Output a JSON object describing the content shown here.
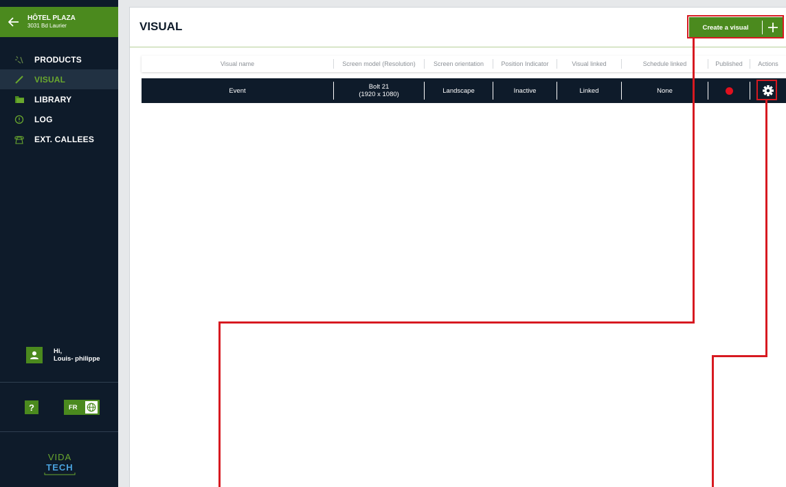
{
  "hotel": {
    "name": "HÔTEL PLAZA",
    "address": "3031 Bd Laurier"
  },
  "nav": {
    "items": [
      {
        "label": "PRODUCTS",
        "icon": "sparkle-icon"
      },
      {
        "label": "VISUAL",
        "icon": "brush-icon",
        "active": true
      },
      {
        "label": "LIBRARY",
        "icon": "folder-icon"
      },
      {
        "label": "LOG",
        "icon": "alert-circle-icon"
      },
      {
        "label": "EXT. CALLEES",
        "icon": "phone-icon"
      }
    ]
  },
  "user": {
    "greeting": "Hi,",
    "name": "Louis- philippe"
  },
  "help_label": "?",
  "language_label": "FR",
  "brand": {
    "line1": "VIDA",
    "line2": "TECH"
  },
  "page": {
    "title": "VISUAL",
    "create_label": "Create a visual",
    "plus_label": "+"
  },
  "table": {
    "columns": [
      "Visual name",
      "Screen model (Resolution)",
      "Screen orientation",
      "Position Indicator",
      "Visual linked",
      "Schedule linked",
      "Published",
      "Actions"
    ],
    "rows": [
      {
        "visual_name": "Event",
        "screen_model": "Bolt 21",
        "resolution": "(1920 x 1080)",
        "orientation": "Landscape",
        "position_indicator": "Inactive",
        "visual_linked": "Linked",
        "schedule_linked": "None",
        "published": false
      }
    ]
  },
  "colors": {
    "sidebar_bg": "#0e1b2a",
    "accent_green": "#4b8a1e",
    "active_text": "#6aa82e",
    "published_dot": "#e0101e",
    "annotation_red": "#d71920"
  }
}
